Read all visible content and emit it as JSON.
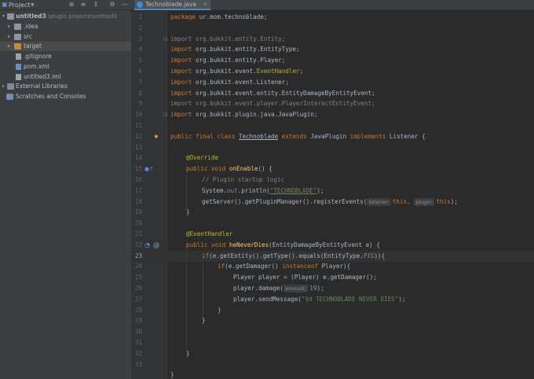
{
  "project_panel": {
    "title": "Project",
    "tree": [
      {
        "label": "untitled3",
        "path": "F:\\plugin projects\\untitled3"
      },
      {
        "label": ".idea"
      },
      {
        "label": "src"
      },
      {
        "label": "target"
      },
      {
        "label": ".gitignore"
      },
      {
        "label": "pom.xml"
      },
      {
        "label": "untitled3.iml"
      },
      {
        "label": "External Libraries"
      },
      {
        "label": "Scratches and Consoles"
      }
    ]
  },
  "editor": {
    "tab_label": "Technoblade.java",
    "current_line": "23",
    "line_numbers": [
      "1",
      "2",
      "3",
      "4",
      "5",
      "6",
      "7",
      "8",
      "9",
      "10",
      "11",
      "12",
      "13",
      "14",
      "15",
      "16",
      "17",
      "18",
      "19",
      "20",
      "21",
      "22",
      "23",
      "24",
      "25",
      "26",
      "27",
      "28",
      "29",
      "30",
      "31",
      "32",
      "33"
    ],
    "code": {
      "l1_package": "package",
      "l1_name": " ur.mom.technoblade;",
      "import_kw": "import",
      "imp3": " org.bukkit.entity.Entity;",
      "imp4": " org.bukkit.entity.EntityType;",
      "imp5": " org.bukkit.entity.Player;",
      "imp6_a": " org.bukkit.event.",
      "imp6_b": "EventHandler",
      "imp6_c": ";",
      "imp7": " org.bukkit.event.Listener;",
      "imp8": " org.bukkit.event.entity.EntityDamageByEntityEvent;",
      "imp9": "import org.bukkit.event.player.PlayerInteractEntityEvent;",
      "imp10": " org.bukkit.plugin.java.JavaPlugin;",
      "l12_a": "public final class ",
      "l12_b": "Technoblade",
      "l12_c": " extends ",
      "l12_d": "JavaPlugin ",
      "l12_e": "implements ",
      "l12_f": "Listener {",
      "l14": "@Override",
      "l15_a": "public void ",
      "l15_b": "onEnable",
      "l15_c": "() {",
      "l16": "// Plugin startup logic",
      "l17_a": "System.",
      "l17_b": "out",
      "l17_c": ".println(",
      "l17_d": "\"TECHNOBLADE\"",
      "l17_e": ");",
      "l18_a": "getServer().getPluginManager().registerEvents(",
      "l18_hint1": "listener:",
      "l18_b": "this",
      "l18_c": ", ",
      "l18_hint2": "plugin:",
      "l18_d": "this",
      "l18_e": ");",
      "close": "}",
      "l21": "@EventHandler",
      "l22_a": "public void ",
      "l22_b": "heNeverDies",
      "l22_c": "(EntityDamageByEntityEvent e) {",
      "l23_a": "if",
      "l23_b": "(e.getEntity().getType().equals(EntityType.",
      "l23_c": "PIG",
      "l23_d": ")){",
      "l24_a": "if",
      "l24_b": "(e.getDamager() ",
      "l24_c": "instanceof",
      "l24_d": " Player){",
      "l25": "Player player = (Player) e.getDamager();",
      "l26_a": "player.damage(",
      "l26_hint": "amount:",
      "l26_b": "19",
      "l26_c": ");",
      "l27_a": "player.sendMessage(",
      "l27_b": "\"§d TECHNOBLADE NEVER DIES\"",
      "l27_c": ");"
    }
  },
  "colors": {
    "editor_bg": "#2b2b2b",
    "keyword": "#cc7832",
    "annotation": "#bbb529",
    "string": "#6a8759",
    "method": "#ffc66d",
    "number": "#6897bb",
    "field": "#9876aa"
  },
  "icons": [
    "project-icon",
    "globe-icon",
    "collapse-icon",
    "expand-icon",
    "gear-icon",
    "minimize-icon",
    "folder-icon",
    "java-file-icon",
    "run-icon",
    "override-icon",
    "listener-icon"
  ]
}
